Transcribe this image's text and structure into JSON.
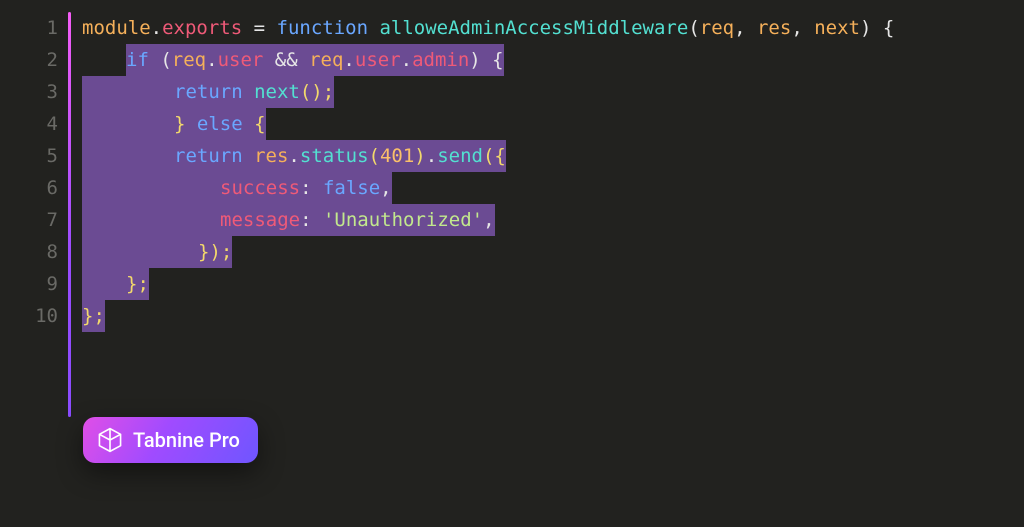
{
  "editor": {
    "line_count": 10,
    "line_numbers": [
      "1",
      "2",
      "3",
      "4",
      "5",
      "6",
      "7",
      "8",
      "9",
      "10"
    ],
    "tokens": {
      "module": "module",
      "dot": ".",
      "exports": "exports",
      "eq": " = ",
      "function": "function",
      "fn_name": " alloweAdminAccessMiddleware",
      "lparen": "(",
      "req": "req",
      "comma_sp": ", ",
      "res": "res",
      "next": "next",
      "rparen_brace": ") {",
      "if": "if",
      "user": "user",
      "and": " && ",
      "admin": "admin",
      "if_close": ") {",
      "return": "return",
      "next_call": " next",
      "call_close": "();",
      "else_seg": "} else {",
      "status": "status",
      "status_num": "401",
      "send": "send",
      "send_open": "({",
      "success_key": "success",
      "colon_sp": ": ",
      "false_val": "false",
      "comma": ",",
      "message_key": "message",
      "unauth_str": "'Unauthorized'",
      "obj_close": "});",
      "brace_semi": "};"
    }
  },
  "badge": {
    "label": "Tabnine Pro"
  }
}
